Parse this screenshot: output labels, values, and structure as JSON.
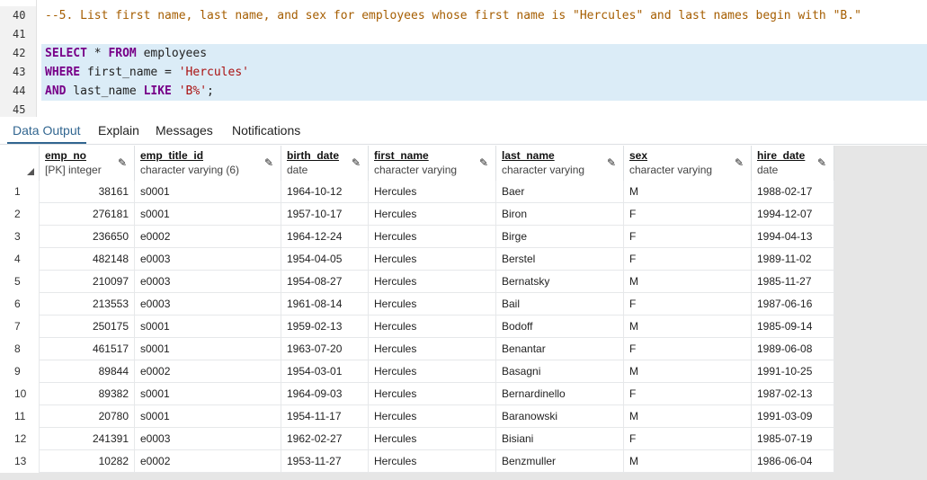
{
  "editor": {
    "lines": [
      {
        "num": "40",
        "highlight": false,
        "tokens": [
          {
            "t": "--5. List first name, last name, and sex for employees whose first name is \"Hercules\" and last names begin with \"B.\"",
            "c": "comment"
          }
        ]
      },
      {
        "num": "41",
        "highlight": false,
        "tokens": []
      },
      {
        "num": "42",
        "highlight": true,
        "tokens": [
          {
            "t": "SELECT",
            "c": "kw"
          },
          {
            "t": " * ",
            "c": "id"
          },
          {
            "t": "FROM",
            "c": "kw"
          },
          {
            "t": " employees",
            "c": "id"
          }
        ]
      },
      {
        "num": "43",
        "highlight": true,
        "tokens": [
          {
            "t": "WHERE",
            "c": "kw"
          },
          {
            "t": " first_name = ",
            "c": "id"
          },
          {
            "t": "'Hercules'",
            "c": "str"
          }
        ]
      },
      {
        "num": "44",
        "highlight": true,
        "tokens": [
          {
            "t": "AND",
            "c": "kw"
          },
          {
            "t": " last_name ",
            "c": "id"
          },
          {
            "t": "LIKE",
            "c": "kw"
          },
          {
            "t": " ",
            "c": "id"
          },
          {
            "t": "'B%'",
            "c": "str"
          },
          {
            "t": ";",
            "c": "id"
          }
        ]
      },
      {
        "num": "45",
        "highlight": false,
        "tokens": []
      }
    ]
  },
  "tabs": [
    {
      "label": "Data Output",
      "active": true
    },
    {
      "label": "Explain",
      "active": false
    },
    {
      "label": "Messages",
      "active": false
    },
    {
      "label": "Notifications",
      "active": false
    }
  ],
  "grid": {
    "columns": [
      {
        "name": "emp_no",
        "type": "[PK] integer",
        "editable": true
      },
      {
        "name": "emp_title_id",
        "type": "character varying (6)",
        "editable": true
      },
      {
        "name": "birth_date",
        "type": "date",
        "editable": true
      },
      {
        "name": "first_name",
        "type": "character varying",
        "editable": true
      },
      {
        "name": "last_name",
        "type": "character varying",
        "editable": true
      },
      {
        "name": "sex",
        "type": "character varying",
        "editable": true
      },
      {
        "name": "hire_date",
        "type": "date",
        "editable": true
      }
    ],
    "rows": [
      [
        "1",
        "38161",
        "s0001",
        "1964-10-12",
        "Hercules",
        "Baer",
        "M",
        "1988-02-17"
      ],
      [
        "2",
        "276181",
        "s0001",
        "1957-10-17",
        "Hercules",
        "Biron",
        "F",
        "1994-12-07"
      ],
      [
        "3",
        "236650",
        "e0002",
        "1964-12-24",
        "Hercules",
        "Birge",
        "F",
        "1994-04-13"
      ],
      [
        "4",
        "482148",
        "e0003",
        "1954-04-05",
        "Hercules",
        "Berstel",
        "F",
        "1989-11-02"
      ],
      [
        "5",
        "210097",
        "e0003",
        "1954-08-27",
        "Hercules",
        "Bernatsky",
        "M",
        "1985-11-27"
      ],
      [
        "6",
        "213553",
        "e0003",
        "1961-08-14",
        "Hercules",
        "Bail",
        "F",
        "1987-06-16"
      ],
      [
        "7",
        "250175",
        "s0001",
        "1959-02-13",
        "Hercules",
        "Bodoff",
        "M",
        "1985-09-14"
      ],
      [
        "8",
        "461517",
        "s0001",
        "1963-07-20",
        "Hercules",
        "Benantar",
        "F",
        "1989-06-08"
      ],
      [
        "9",
        "89844",
        "e0002",
        "1954-03-01",
        "Hercules",
        "Basagni",
        "M",
        "1991-10-25"
      ],
      [
        "10",
        "89382",
        "s0001",
        "1964-09-03",
        "Hercules",
        "Bernardinello",
        "F",
        "1987-02-13"
      ],
      [
        "11",
        "20780",
        "s0001",
        "1954-11-17",
        "Hercules",
        "Baranowski",
        "M",
        "1991-03-09"
      ],
      [
        "12",
        "241391",
        "e0003",
        "1962-02-27",
        "Hercules",
        "Bisiani",
        "F",
        "1985-07-19"
      ],
      [
        "13",
        "10282",
        "e0002",
        "1953-11-27",
        "Hercules",
        "Benzmuller",
        "M",
        "1986-06-04"
      ]
    ]
  },
  "colors": {
    "accent": "#326690",
    "highlight": "#dbecf7",
    "keyword": "#770088",
    "string": "#aa1111",
    "comment": "#a55d00"
  }
}
